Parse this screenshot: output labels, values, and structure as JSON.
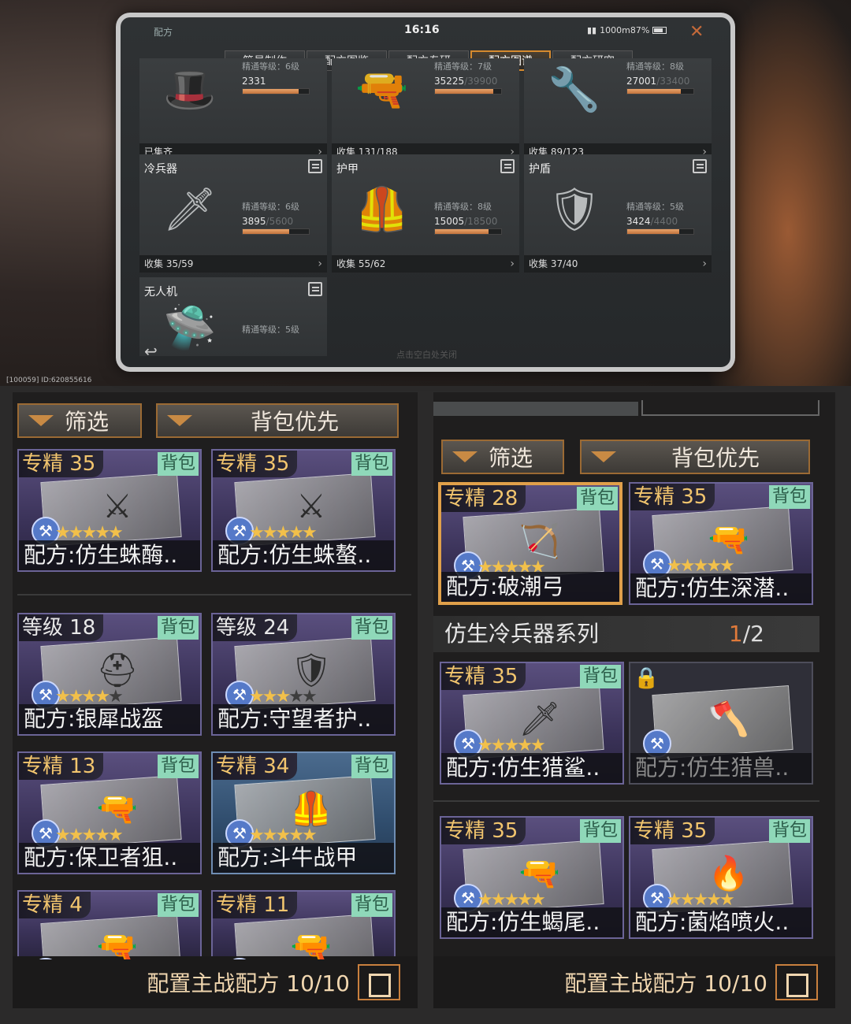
{
  "top": {
    "status": {
      "title": "配方",
      "time": "16:16",
      "battery": "1000m87%",
      "close": "✕"
    },
    "tabs": [
      "简易制作",
      "配方图鉴",
      "配方专研",
      "配方图谱",
      "配方研究"
    ],
    "active_tab": 3,
    "categories": [
      {
        "name": "",
        "level": "精通等级：6级",
        "progress": "2331",
        "total": "",
        "fill": 0.85,
        "footer": "已集齐",
        "icon": "🎩"
      },
      {
        "name": "",
        "level": "精通等级：7级",
        "progress": "35225",
        "total": "/39900",
        "fill": 0.88,
        "footer": "收集 131/188",
        "icon": "🔫"
      },
      {
        "name": "",
        "level": "精通等级：8级",
        "progress": "27001",
        "total": "/33400",
        "fill": 0.81,
        "footer": "收集 89/123",
        "icon": "🔧"
      },
      {
        "name": "冷兵器",
        "level": "精通等级：6级",
        "progress": "3895",
        "total": "/5600",
        "fill": 0.7,
        "footer": "收集 35/59",
        "icon": "🗡"
      },
      {
        "name": "护甲",
        "level": "精通等级：8级",
        "progress": "15005",
        "total": "/18500",
        "fill": 0.81,
        "footer": "收集 55/62",
        "icon": "🦺"
      },
      {
        "name": "护盾",
        "level": "精通等级：5级",
        "progress": "3424",
        "total": "/4400",
        "fill": 0.78,
        "footer": "收集 37/40",
        "icon": "🛡"
      },
      {
        "name": "无人机",
        "level": "精通等级：5级",
        "progress": "",
        "total": "",
        "fill": 0,
        "footer": "",
        "icon": "🛸"
      }
    ],
    "hint": "点击空白处关闭",
    "device_info": "[100059] ID:620855616"
  },
  "left": {
    "filter": "筛选",
    "sort": "背包优先",
    "cards": [
      {
        "badge": "专精 35",
        "badge_type": "mastery",
        "bag": "背包",
        "name": "配方:仿生蛛酶..",
        "stars": 5,
        "teal": false,
        "icon": "⚔"
      },
      {
        "badge": "专精 35",
        "badge_type": "mastery",
        "bag": "背包",
        "name": "配方:仿生蛛螯..",
        "stars": 5,
        "teal": false,
        "icon": "⚔"
      },
      {
        "badge": "等级 18",
        "badge_type": "level",
        "bag": "背包",
        "name": "配方:银犀战盔",
        "stars": 4,
        "teal": false,
        "icon": "⛑"
      },
      {
        "badge": "等级 24",
        "badge_type": "level",
        "bag": "背包",
        "name": "配方:守望者护..",
        "stars": 3,
        "teal": false,
        "icon": "🛡"
      },
      {
        "badge": "专精 13",
        "badge_type": "mastery",
        "bag": "背包",
        "name": "配方:保卫者狙..",
        "stars": 5,
        "teal": false,
        "icon": "🔫"
      },
      {
        "badge": "专精 34",
        "badge_type": "mastery",
        "bag": "背包",
        "name": "配方:斗牛战甲",
        "stars": 5,
        "teal": true,
        "icon": "🦺"
      },
      {
        "badge": "专精 4",
        "badge_type": "mastery",
        "bag": "背包",
        "name": "",
        "stars": 0,
        "teal": false,
        "icon": "🔫"
      },
      {
        "badge": "专精 11",
        "badge_type": "mastery",
        "bag": "背包",
        "name": "",
        "stars": 0,
        "teal": false,
        "icon": "🔫"
      }
    ],
    "footer": "配置主战配方 10/10"
  },
  "right": {
    "filter": "筛选",
    "sort": "背包优先",
    "cards_top": [
      {
        "badge": "专精 28",
        "bag": "背包",
        "name": "配方:破潮弓",
        "stars": 5,
        "selected": true,
        "icon": "🏹"
      },
      {
        "badge": "专精 35",
        "bag": "背包",
        "name": "配方:仿生深潜..",
        "stars": 5,
        "selected": false,
        "icon": "🔫"
      }
    ],
    "series": {
      "name": "仿生冷兵器系列",
      "count": "1",
      "total": "/2"
    },
    "cards_series": [
      {
        "badge": "专精 35",
        "bag": "背包",
        "name": "配方:仿生猎鲨..",
        "stars": 5,
        "locked": false,
        "icon": "🗡"
      },
      {
        "badge": "",
        "bag": "",
        "name": "配方:仿生猎兽..",
        "stars": 0,
        "locked": true,
        "icon": "🪓"
      }
    ],
    "cards_bottom": [
      {
        "badge": "专精 35",
        "bag": "背包",
        "name": "配方:仿生蝎尾..",
        "stars": 5,
        "icon": "🔫"
      },
      {
        "badge": "专精 35",
        "bag": "背包",
        "name": "配方:菌焰喷火..",
        "stars": 5,
        "icon": "🔥"
      }
    ],
    "footer": "配置主战配方 10/10"
  }
}
